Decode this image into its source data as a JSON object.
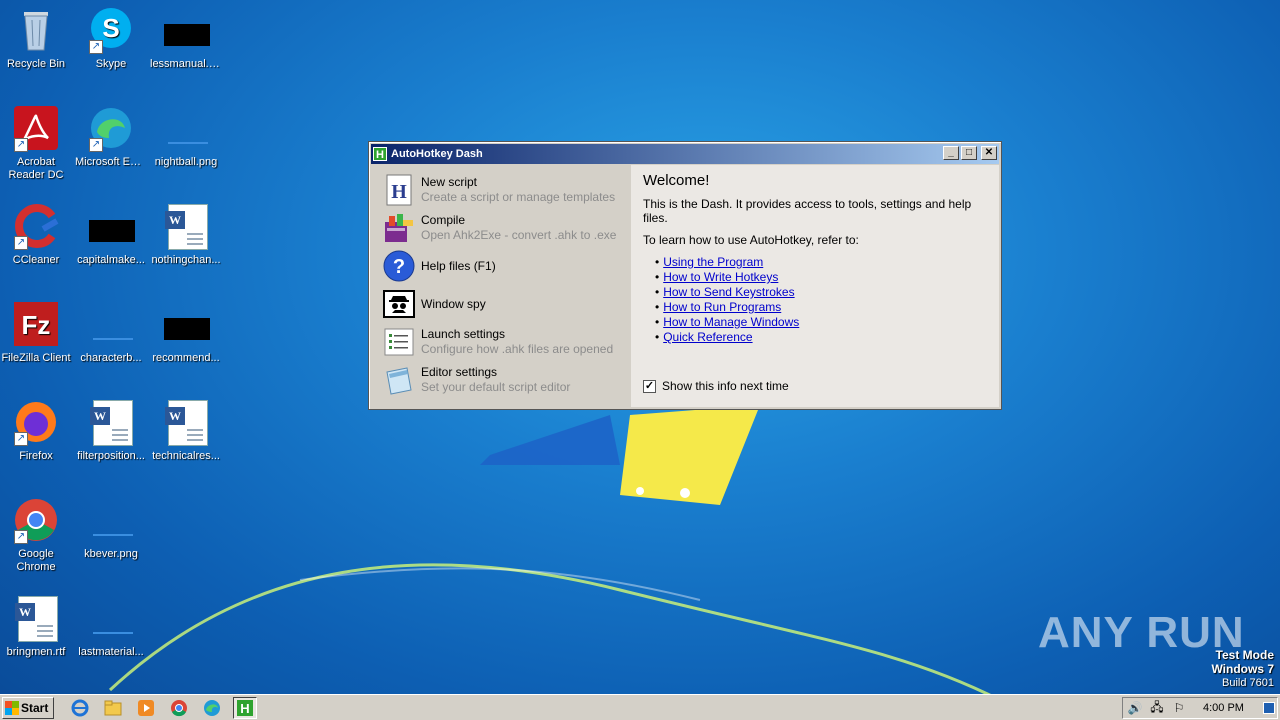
{
  "desktop": {
    "icons": [
      {
        "label": "Recycle Bin"
      },
      {
        "label": "Skype"
      },
      {
        "label": "lessmanual.jpg"
      },
      {
        "label": "Acrobat Reader DC"
      },
      {
        "label": "Microsoft Edge"
      },
      {
        "label": "nightball.png"
      },
      {
        "label": "CCleaner"
      },
      {
        "label": "capitalmake..."
      },
      {
        "label": "nothingchan..."
      },
      {
        "label": "FileZilla Client"
      },
      {
        "label": "characterb..."
      },
      {
        "label": "recommend..."
      },
      {
        "label": "Firefox"
      },
      {
        "label": "filterposition..."
      },
      {
        "label": "technicalres..."
      },
      {
        "label": "Google Chrome"
      },
      {
        "label": "kbever.png"
      },
      {
        "label": "bringmen.rtf"
      },
      {
        "label": "lastmaterial..."
      }
    ]
  },
  "window": {
    "title": "AutoHotkey Dash",
    "menu": [
      {
        "title": "New script",
        "subtitle": "Create a script or manage templates",
        "icon": "new-script-icon"
      },
      {
        "title": "Compile",
        "subtitle": "Open Ahk2Exe - convert .ahk to .exe",
        "icon": "compile-icon"
      },
      {
        "title": "Help files (F1)",
        "subtitle": "",
        "icon": "help-icon"
      },
      {
        "title": "Window spy",
        "subtitle": "",
        "icon": "spy-icon"
      },
      {
        "title": "Launch settings",
        "subtitle": "Configure how .ahk files are opened",
        "icon": "list-icon"
      },
      {
        "title": "Editor settings",
        "subtitle": "Set your default script editor",
        "icon": "notepad-icon"
      }
    ],
    "welcome": {
      "heading": "Welcome!",
      "intro": "This is the Dash. It provides access to tools, settings and help files.",
      "learn": "To learn how to use AutoHotkey, refer to:",
      "links": [
        "Using the Program",
        "How to Write Hotkeys",
        "How to Send Keystrokes",
        "How to Run Programs",
        "How to Manage Windows",
        "Quick Reference"
      ],
      "show_info_label": "Show this info next time",
      "show_info_checked": true
    }
  },
  "taskbar": {
    "start_label": "Start",
    "clock": "4:00 PM"
  },
  "watermark": "ANY RUN",
  "test_mode": {
    "line1": "Test Mode",
    "line2": "Windows 7",
    "line3": "Build 7601"
  }
}
